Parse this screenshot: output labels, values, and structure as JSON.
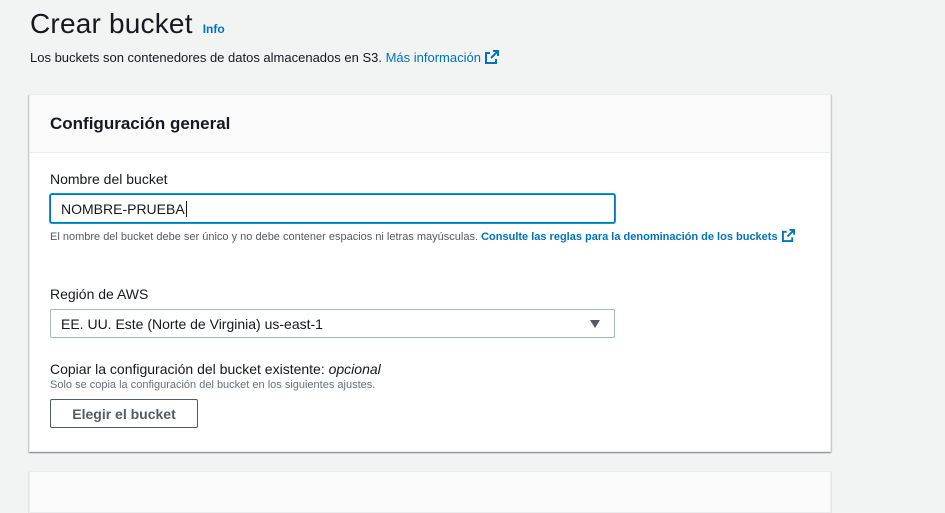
{
  "header": {
    "title": "Crear bucket",
    "info_label": "Info",
    "description": "Los buckets son contenedores de datos almacenados en S3.",
    "more_info_link": "Más información",
    "external_icon": "external-link-icon"
  },
  "general_config": {
    "title": "Configuración general",
    "bucket_name": {
      "label": "Nombre del bucket",
      "value": "NOMBRE-PRUEBA",
      "constraint": "El nombre del bucket debe ser único y no debe contener espacios ni letras mayúsculas.",
      "rules_link": "Consulte las reglas para la denominación de los buckets"
    },
    "region": {
      "label": "Región de AWS",
      "selected": "EE. UU. Este (Norte de Virginia) us-east-1",
      "icon": "caret-down-icon"
    },
    "copy_settings": {
      "label": "Copiar la configuración del bucket existente:",
      "optional": "opcional",
      "description": "Solo se copia la configuración del bucket en los siguientes ajustes.",
      "button_label": "Elegir el bucket"
    }
  },
  "colors": {
    "link": "#0073bb",
    "focus": "#00a1c9",
    "background": "#f2f3f3"
  }
}
